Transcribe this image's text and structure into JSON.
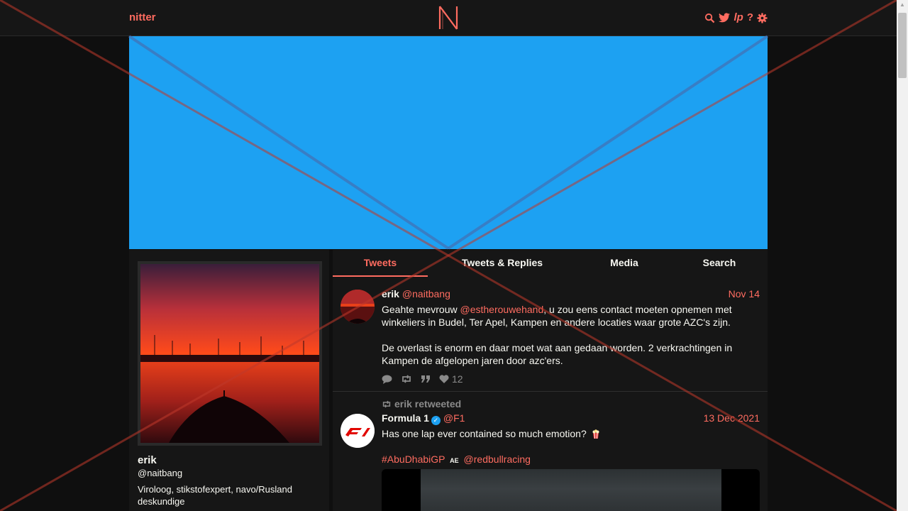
{
  "nav": {
    "brand": "nitter",
    "logo_letter": "N",
    "icons": [
      "search-icon",
      "twitter-icon",
      "rss-icon",
      "help-icon",
      "settings-icon"
    ],
    "icon_glyphs": {
      "rss": "lp",
      "help": "?"
    }
  },
  "profile": {
    "name": "erik",
    "handle": "@naitbang",
    "bio": "Viroloog, stikstofexpert, navo/Rusland deskundige"
  },
  "tabs": [
    "Tweets",
    "Tweets & Replies",
    "Media",
    "Search"
  ],
  "tweets": [
    {
      "fullname": "erik",
      "username": "@naitbang",
      "date": "Nov 14",
      "text_pre": "Geahte mevrouw ",
      "mention": "@estherouwehand",
      "text_post": ", u zou eens contact moeten opnemen met winkeliers in Budel, Ter Apel, Kampen en andere locaties waar grote AZC's zijn.",
      "text2": "De overlast is enorm en daar moet wat aan gedaan worden. 2 verkrachtingen in Kampen de afgelopen jaren door azc'ers.",
      "likes": "12"
    },
    {
      "retweet_label": "erik retweeted",
      "fullname": "Formula 1",
      "username": "@F1",
      "date": "13 Dec 2021",
      "text": "Has one lap ever contained so much emotion?",
      "hashtag": "#AbuDhabiGP",
      "flag": "AE",
      "mention": "@redbullracing"
    }
  ],
  "colors": {
    "accent": "#ff6c60",
    "banner": "#1da1f2",
    "background": "#0f0f0f",
    "panel": "#161616",
    "overlay_red": "#c0392b",
    "overlay_blue": "#4a67a8"
  }
}
